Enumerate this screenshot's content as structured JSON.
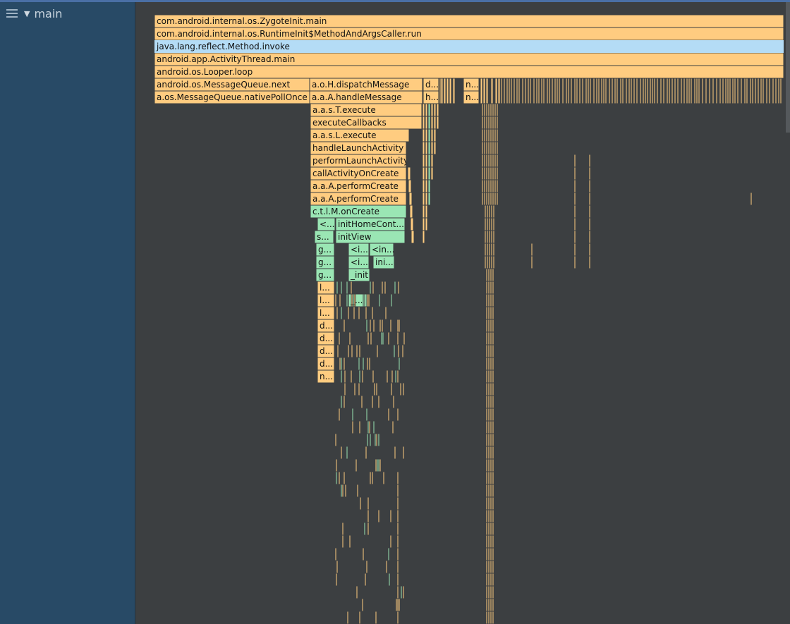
{
  "sidebar": {
    "thread_name": "main",
    "icons": [
      "menu-icon",
      "chevron-down-icon"
    ]
  },
  "colors": {
    "frame_app": "#ffcc80",
    "frame_user": "#9ae6b4",
    "frame_selected": "#b4dcf6",
    "background": "#3c3f41",
    "sidebar": "#284a66"
  },
  "frames": [
    {
      "label": "com.android.internal.os.ZygoteInit.main"
    },
    {
      "label": "com.android.internal.os.RuntimeInit$MethodAndArgsCaller.run"
    },
    {
      "label": "java.lang.reflect.Method.invoke"
    },
    {
      "label": "android.app.ActivityThread.main"
    },
    {
      "label": "android.os.Looper.loop"
    },
    {
      "label": "android.os.MessageQueue.next"
    },
    {
      "label": "a.o.H.dispatchMessage"
    },
    {
      "label": "d..."
    },
    {
      "label": "n..."
    },
    {
      "label": "a.os.MessageQueue.nativePollOnce"
    },
    {
      "label": "a.a.A.handleMessage"
    },
    {
      "label": "h..."
    },
    {
      "label": "n..."
    },
    {
      "label": "a.a.s.T.execute"
    },
    {
      "label": "executeCallbacks"
    },
    {
      "label": "a.a.s.L.execute"
    },
    {
      "label": "handleLaunchActivity"
    },
    {
      "label": "performLaunchActivity"
    },
    {
      "label": "callActivityOnCreate"
    },
    {
      "label": "a.a.A.performCreate"
    },
    {
      "label": "a.a.A.performCreate"
    },
    {
      "label": "c.t.l.M.onCreate"
    },
    {
      "label": "<..."
    },
    {
      "label": "initHomeCont..."
    },
    {
      "label": "s..."
    },
    {
      "label": "initView"
    },
    {
      "label": "g..."
    },
    {
      "label": "<i..."
    },
    {
      "label": "<in..."
    },
    {
      "label": "g..."
    },
    {
      "label": "<i..."
    },
    {
      "label": "ini..."
    },
    {
      "label": "g..."
    },
    {
      "label": "_init"
    },
    {
      "label": "l..."
    },
    {
      "label": "l..."
    },
    {
      "label": "_..."
    },
    {
      "label": "l..."
    },
    {
      "label": "d..."
    },
    {
      "label": "d..."
    },
    {
      "label": "d..."
    },
    {
      "label": "d..."
    },
    {
      "label": "n..."
    }
  ]
}
